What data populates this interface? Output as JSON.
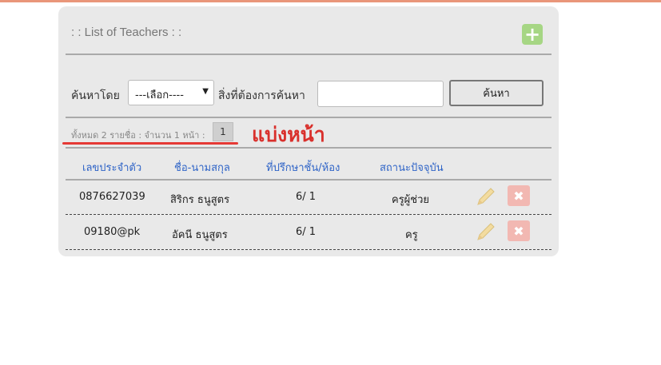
{
  "panel": {
    "title": ": : List of Teachers : :",
    "add_icon_label": "+"
  },
  "search": {
    "by_label": "ค้นหาโดย",
    "select_value": "---เลือก----",
    "query_label": "สิ่งที่ต้องการค้นหา",
    "input_value": "",
    "button_label": "ค้นหา"
  },
  "pager": {
    "summary": "ทั้งหมด 2 รายชื่อ : จำนวน 1 หน้า :",
    "current_page": "1"
  },
  "annotation": {
    "text": "แบ่งหน้า"
  },
  "table": {
    "headers": [
      "เลขประจำตัว",
      "ชื่อ-นามสกุล",
      "ที่ปรึกษาชั้น/ห้อง",
      "สถานะปัจจุบัน"
    ],
    "rows": [
      {
        "id": "0876627039",
        "name": "สิริกร   ธนูสูตร",
        "class": "6/ 1",
        "status": "ครูผู้ช่วย"
      },
      {
        "id": "09180@pk",
        "name": "อัคนี   ธนูสูตร",
        "class": "6/ 1",
        "status": "ครู"
      }
    ]
  },
  "icons": {
    "edit": "pencil-icon",
    "delete": "x-icon",
    "add": "plus-icon"
  },
  "colors": {
    "header_link": "#2f64c7",
    "annotation": "#d9302c",
    "add_button": "#a6d684",
    "delete_button": "#f2b8b2"
  }
}
